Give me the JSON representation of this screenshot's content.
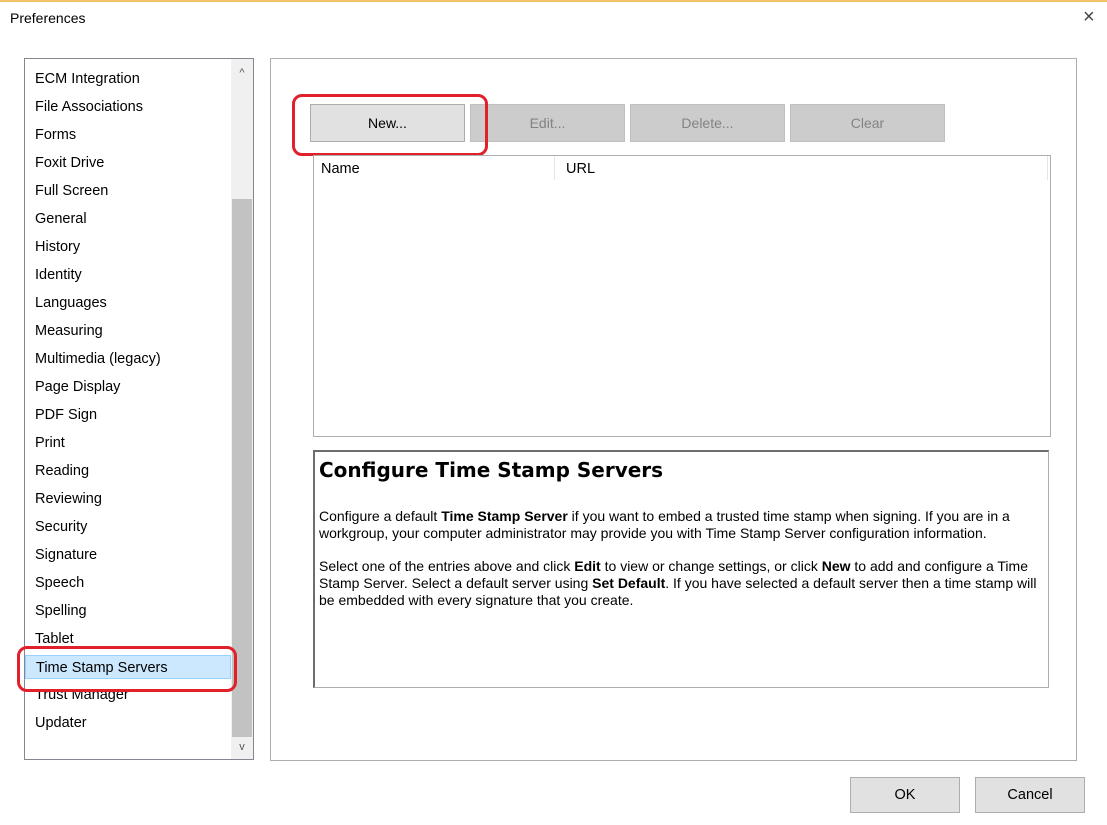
{
  "window": {
    "title": "Preferences",
    "close_symbol": "×"
  },
  "categories": [
    "ECM Integration",
    "File Associations",
    "Forms",
    "Foxit Drive",
    "Full Screen",
    "General",
    "History",
    "Identity",
    "Languages",
    "Measuring",
    "Multimedia (legacy)",
    "Page Display",
    "PDF Sign",
    "Print",
    "Reading",
    "Reviewing",
    "Security",
    "Signature",
    "Speech",
    "Spelling",
    "Tablet",
    "Time Stamp Servers",
    "Trust Manager",
    "Updater"
  ],
  "selected_category": "Time Stamp Servers",
  "toolbar": {
    "new": "New...",
    "edit": "Edit...",
    "delete": "Delete...",
    "clear": "Clear"
  },
  "table": {
    "columns": [
      "Name",
      "URL"
    ],
    "rows": []
  },
  "info": {
    "title": "Configure Time Stamp Servers",
    "p1": [
      {
        "t": "Configure a default "
      },
      {
        "t": "Time Stamp Server",
        "b": true
      },
      {
        "t": " if you want to embed a trusted time stamp when signing. If you are in a workgroup, your computer administrator may provide you with Time Stamp Server configuration information."
      }
    ],
    "p2": [
      {
        "t": "Select one of the entries above and click "
      },
      {
        "t": "Edit",
        "b": true
      },
      {
        "t": " to view or change settings, or click "
      },
      {
        "t": "New",
        "b": true
      },
      {
        "t": " to add and configure a Time Stamp Server. Select a default server using "
      },
      {
        "t": "Set Default",
        "b": true
      },
      {
        "t": ". If you have selected a default server then a time stamp will be embedded with every signature that you create."
      }
    ]
  },
  "footer": {
    "ok": "OK",
    "cancel": "Cancel"
  },
  "scrollbar": {
    "up": "^",
    "down": "v"
  }
}
